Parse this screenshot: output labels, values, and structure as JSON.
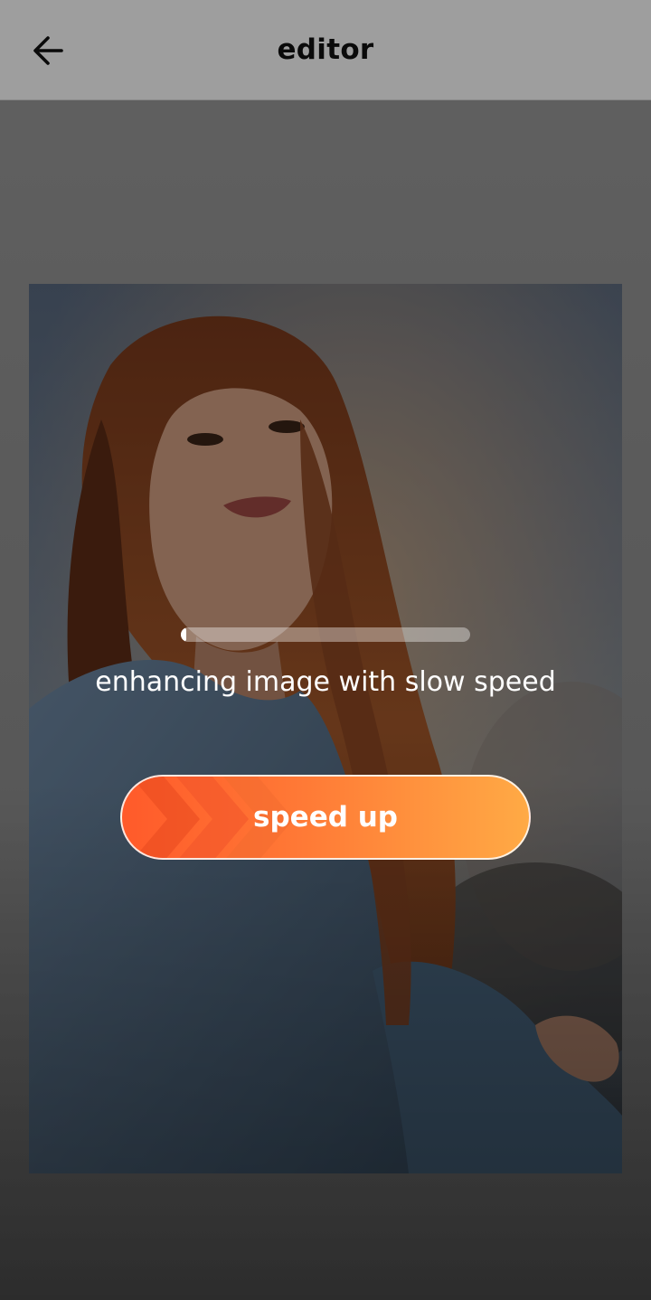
{
  "header": {
    "title": "editor",
    "back_icon": "arrow-left-icon"
  },
  "processing": {
    "progress": 0.02,
    "status_text": "enhancing image with slow speed"
  },
  "speed_button": {
    "label": "speed up",
    "icon": "chevrons-right-icon",
    "gradient_start": "#ff5a2a",
    "gradient_end": "#ffaa45"
  },
  "colors": {
    "overlay": "#000000",
    "title": "#111111"
  }
}
